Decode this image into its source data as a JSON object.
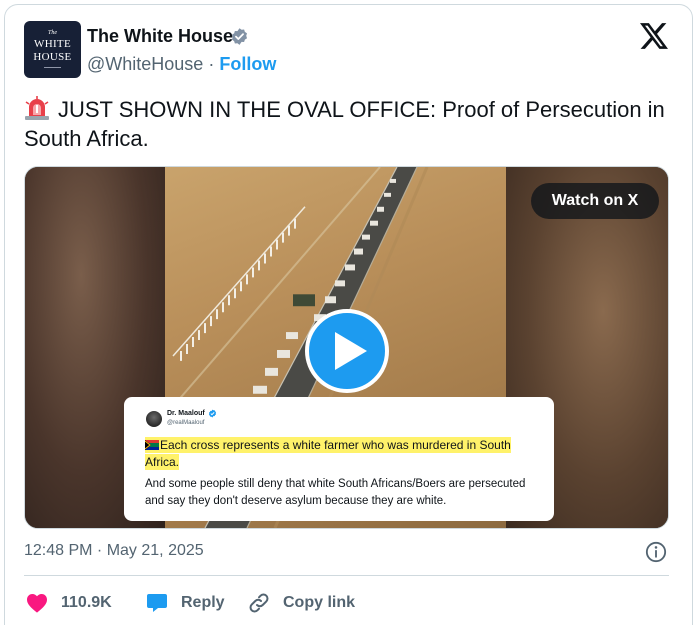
{
  "account": {
    "name": "The White House",
    "handle": "@WhiteHouse",
    "separator": "·",
    "follow_label": "Follow",
    "avatar_text": {
      "the": "The",
      "line1": "WHITE",
      "line2": "HOUSE"
    },
    "verified_color": "#8292a5"
  },
  "tweet": {
    "text": "JUST SHOWN IN THE OVAL OFFICE: Proof of Persecution in South Africa.",
    "emoji_icon": "rotating-light-icon"
  },
  "media": {
    "watch_label": "Watch on X",
    "embedded_post": {
      "author_name": "Dr. Maalouf",
      "author_handle": "@realMaalouf",
      "highlight_line1": "Each cross represents a white farmer who was murdered in South",
      "highlight_line2": "Africa.",
      "body": "And some people still deny that white South Africans/Boers are persecuted and say they don't deserve asylum because they are white."
    }
  },
  "footer": {
    "timestamp": "12:48 PM · May 21, 2025",
    "likes": "110.9K",
    "reply_label": "Reply",
    "copy_label": "Copy link"
  },
  "colors": {
    "accent": "#1d9bf0",
    "like": "#f91880",
    "text_primary": "#0f1419",
    "text_secondary": "#536471",
    "highlight": "#fff26a"
  }
}
